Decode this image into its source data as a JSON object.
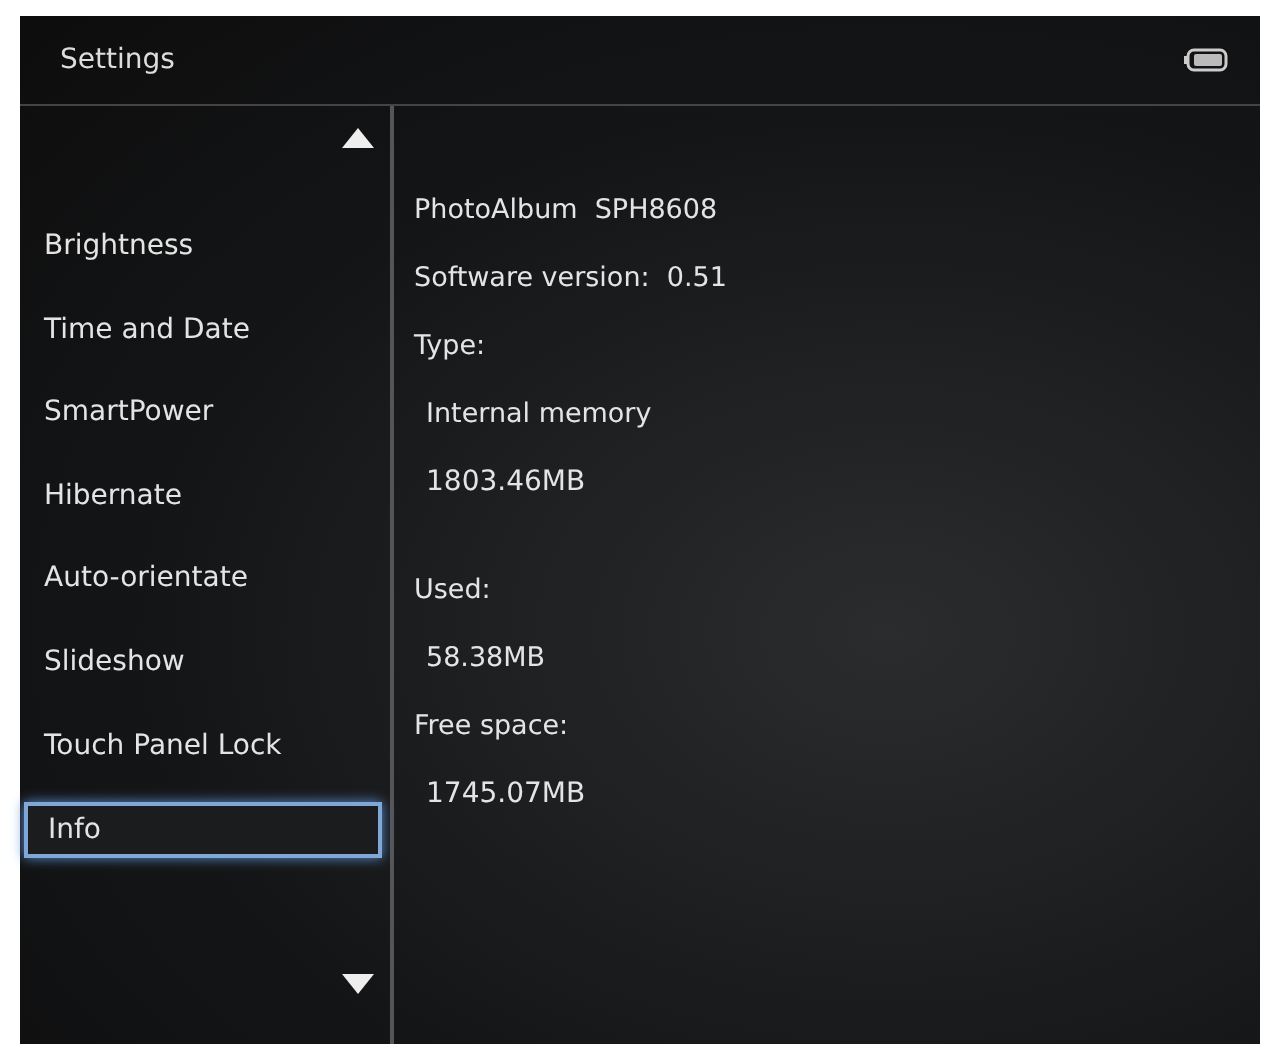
{
  "header": {
    "title": "Settings"
  },
  "menu": {
    "items": [
      {
        "label": "Brightness",
        "selected": false
      },
      {
        "label": "Time and Date",
        "selected": false
      },
      {
        "label": "SmartPower",
        "selected": false
      },
      {
        "label": "Hibernate",
        "selected": false
      },
      {
        "label": "Auto-orientate",
        "selected": false
      },
      {
        "label": "Slideshow",
        "selected": false
      },
      {
        "label": "Touch Panel Lock",
        "selected": false
      },
      {
        "label": "Info",
        "selected": true
      }
    ]
  },
  "info": {
    "rows": [
      {
        "kind": "line",
        "text": "PhotoAlbum  SPH8608"
      },
      {
        "kind": "line",
        "text": "Software version:  0.51"
      },
      {
        "kind": "label",
        "text": "Type:"
      },
      {
        "kind": "value",
        "text": "Internal memory"
      },
      {
        "kind": "amount",
        "text": "1803.46MB"
      },
      {
        "kind": "label",
        "text": "Used:"
      },
      {
        "kind": "value",
        "text": "58.38MB"
      },
      {
        "kind": "label",
        "text": "Free space:"
      },
      {
        "kind": "amount",
        "text": "1745.07MB"
      }
    ]
  }
}
